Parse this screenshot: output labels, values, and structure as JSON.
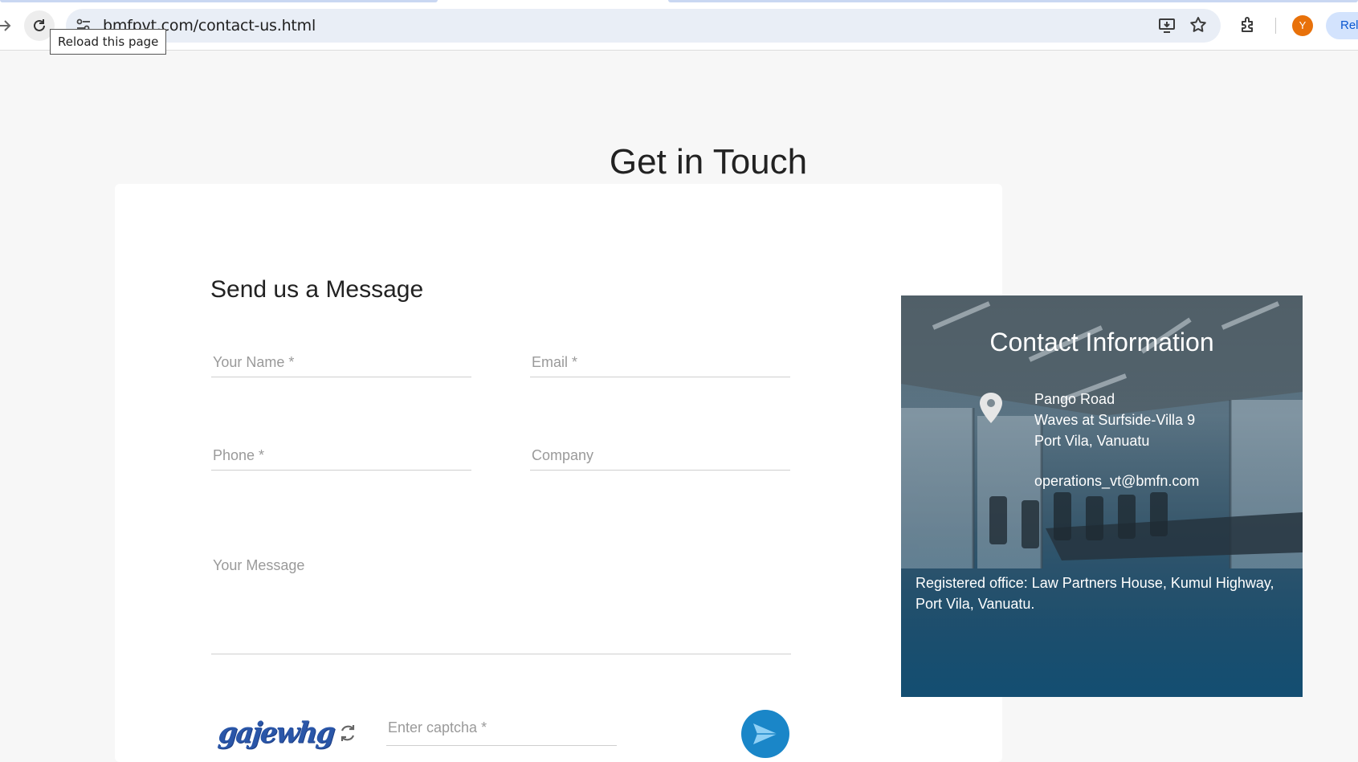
{
  "browser": {
    "url": "bmfpvt.com/contact-us.html",
    "tooltip": "Reload this page",
    "avatar_letter": "Y",
    "relaunch_label": "Rel",
    "icons": [
      "back-arrow-icon",
      "reload-icon",
      "site-info-icon",
      "install-app-icon",
      "bookmark-star-icon",
      "extensions-icon"
    ]
  },
  "page": {
    "title": "Get in Touch"
  },
  "form": {
    "heading": "Send us a Message",
    "name_placeholder": "Your Name *",
    "email_placeholder": "Email *",
    "phone_placeholder": "Phone *",
    "company_placeholder": "Company",
    "message_placeholder": "Your Message",
    "captcha_text": "gajewhg",
    "captcha_placeholder": "Enter captcha *"
  },
  "contact": {
    "title": "Contact Information",
    "address_line1": "Pango Road",
    "address_line2": "Waves at Surfside-Villa 9",
    "address_line3": "Port Vila, Vanuatu",
    "email": "operations_vt@bmfn.com",
    "registered_office": "Registered office: Law Partners House, Kumul Highway, Port Vila, Vanuatu."
  },
  "colors": {
    "send_button": "#1a86c8",
    "avatar": "#e8710a",
    "captcha": "#2a56a8"
  }
}
